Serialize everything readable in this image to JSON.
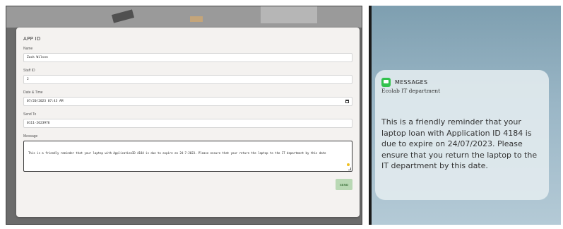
{
  "form": {
    "title": "APP ID",
    "name_label": "Name",
    "name_value": "Zack Wilson",
    "staff_label": "Staff ID",
    "staff_value": "2",
    "datetime_label": "Date & Time",
    "datetime_value": "07/20/2023 07:43 AM",
    "sendto_label": "Send To",
    "sendto_value": "0111-2623976",
    "message_label": "Message",
    "message_value": "This is a friendly reminder that your laptop with ApplicationID 4184 is due to expire on 24-7-2023. Please ensure that your return the laptop to the IT department by this date",
    "send_label": "SEND"
  },
  "notification": {
    "app_name": "MESSAGES",
    "sender": "Ecolab IT department",
    "body": "This is a friendly reminder that your laptop loan with Application ID 4184 is due to expire on 24/07/2023. Please ensure that you return the laptop to the IT department by this date.",
    "app_icon": "messages-icon",
    "app_icon_color": "#33c24d"
  },
  "colors": {
    "send_button_bg": "#b9d8b4",
    "card_bg": "#f4f2f0"
  }
}
